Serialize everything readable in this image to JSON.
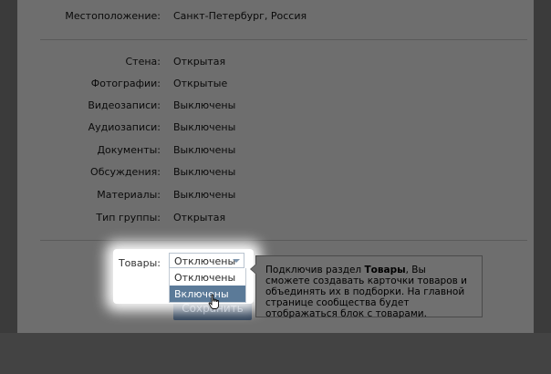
{
  "location": {
    "label": "Местоположение:",
    "value": "Санкт-Петербург, Россия"
  },
  "settings": [
    {
      "label": "Стена:",
      "value": "Открытая"
    },
    {
      "label": "Фотографии:",
      "value": "Открытые"
    },
    {
      "label": "Видеозаписи:",
      "value": "Выключены"
    },
    {
      "label": "Аудиозаписи:",
      "value": "Выключены"
    },
    {
      "label": "Документы:",
      "value": "Выключены"
    },
    {
      "label": "Обсуждения:",
      "value": "Выключены"
    },
    {
      "label": "Материалы:",
      "value": "Выключены"
    },
    {
      "label": "Тип группы:",
      "value": "Открытая"
    }
  ],
  "goods": {
    "label": "Товары:",
    "selected": "Отключены",
    "options": [
      "Отключены",
      "Включены"
    ],
    "hovered_option": "Включены"
  },
  "tooltip": {
    "line1_before": "Подключив раздел ",
    "line1_bold": "Товары",
    "line1_after": ", Вы сможете",
    "rest": "создавать карточки товаров и объединять их в подборки. На главной странице сообщества будет отображаться блок с товарами."
  },
  "save_button": "Сохранить",
  "colors": {
    "selection": "#5b7a98",
    "button": "#2c3e55"
  }
}
